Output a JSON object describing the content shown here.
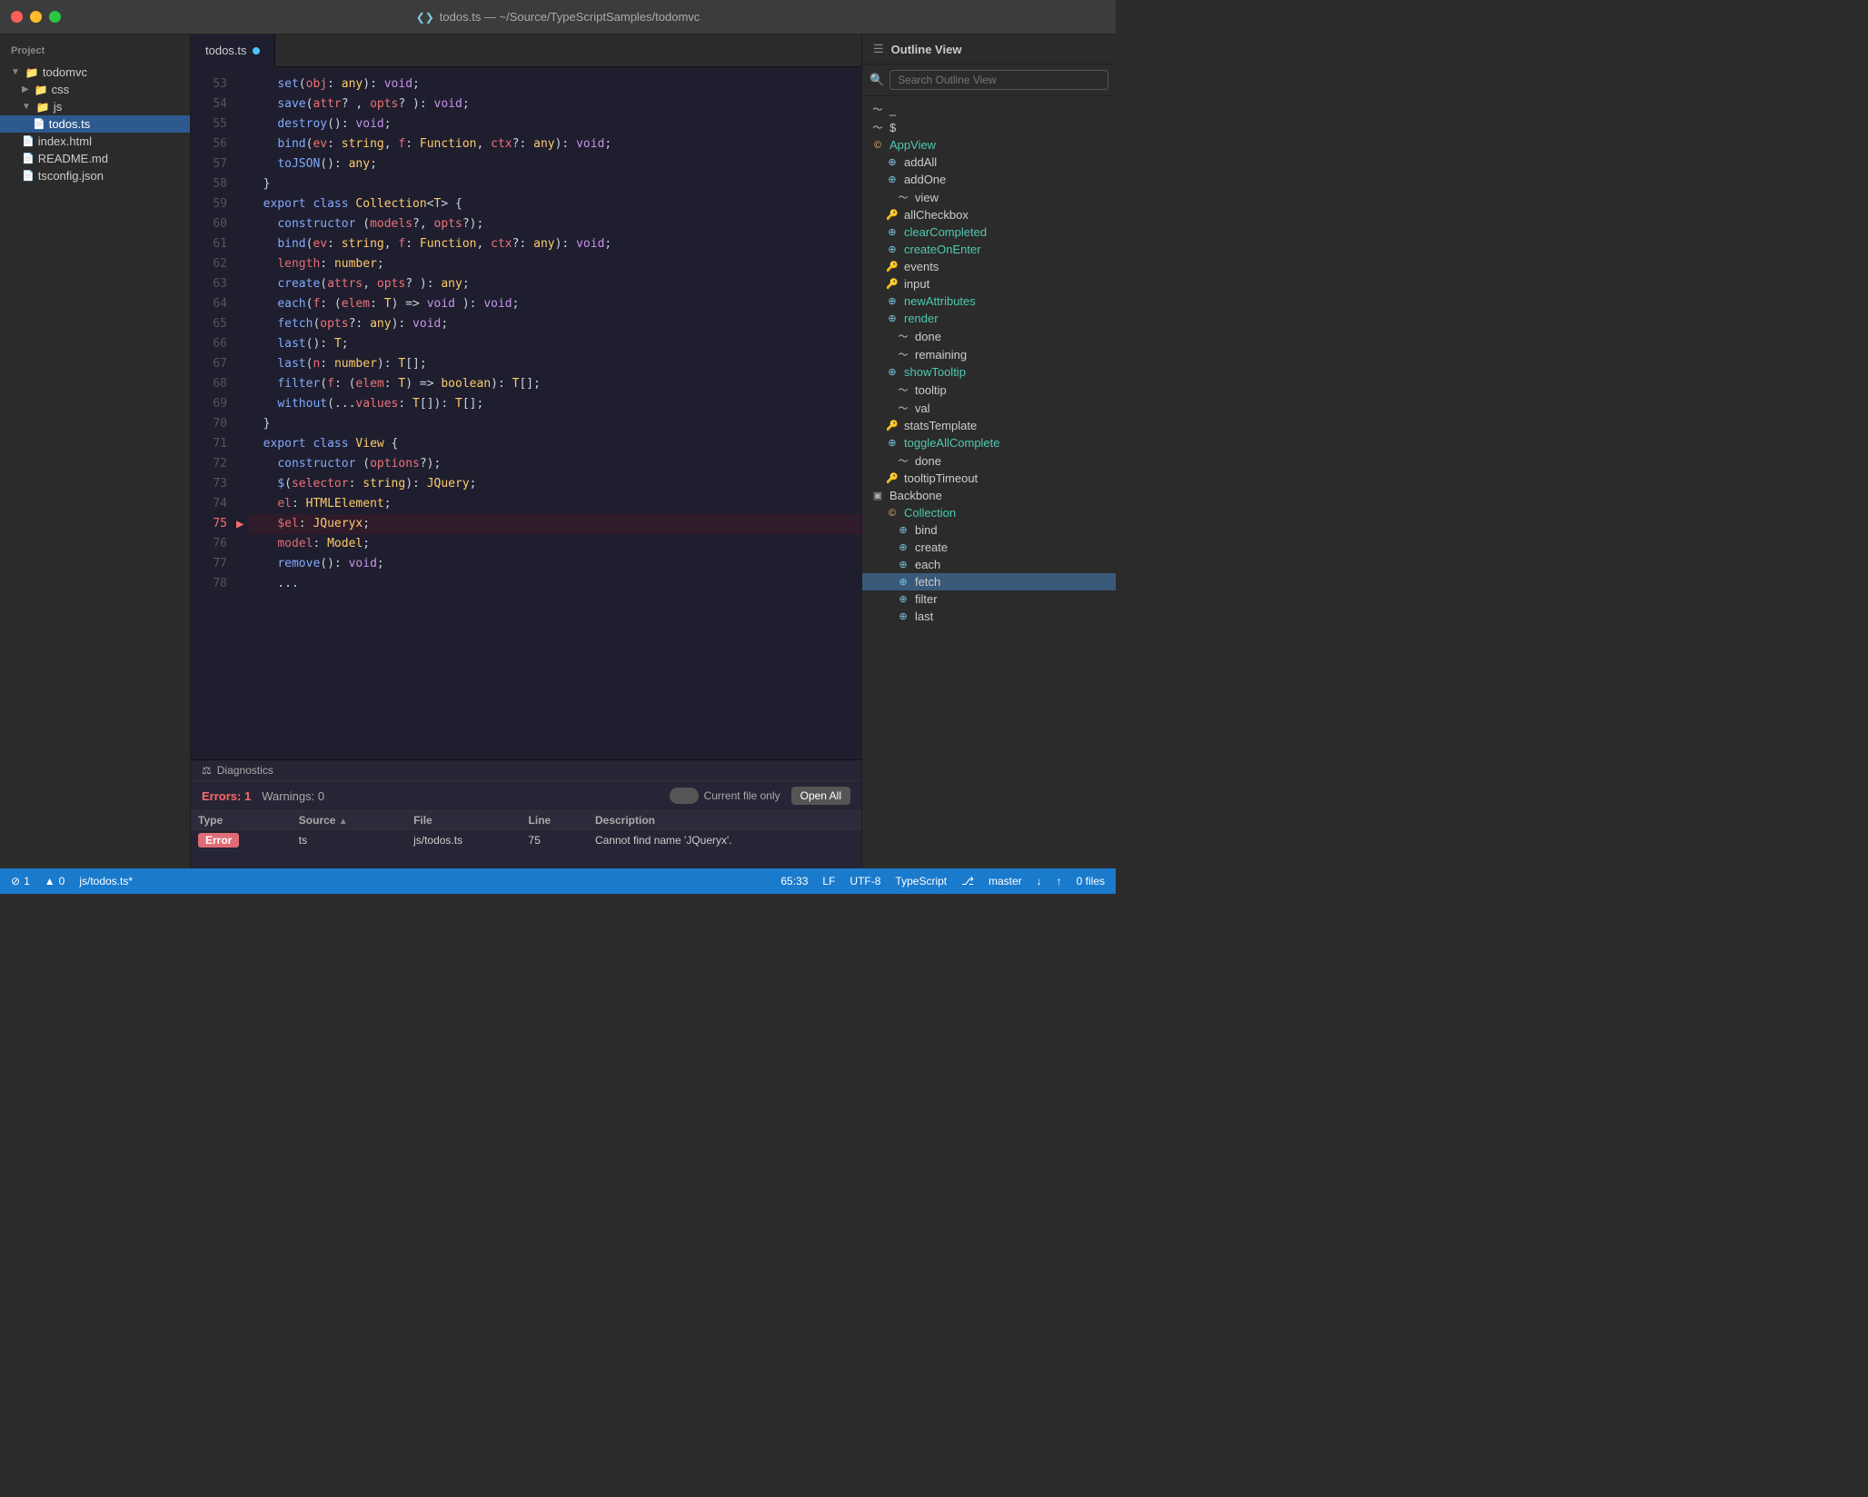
{
  "titleBar": {
    "title": "todos.ts — ~/Source/TypeScriptSamples/todomvc",
    "icon": "❮❯"
  },
  "sidebar": {
    "title": "Project",
    "items": [
      {
        "id": "todomvc",
        "label": "todomvc",
        "type": "folder",
        "level": 0,
        "expanded": true
      },
      {
        "id": "css",
        "label": "css",
        "type": "folder",
        "level": 1,
        "expanded": false
      },
      {
        "id": "js",
        "label": "js",
        "type": "folder",
        "level": 1,
        "expanded": true
      },
      {
        "id": "todos-ts",
        "label": "todos.ts",
        "type": "file",
        "level": 2,
        "selected": true
      },
      {
        "id": "index-html",
        "label": "index.html",
        "type": "file",
        "level": 1
      },
      {
        "id": "readme-md",
        "label": "README.md",
        "type": "file",
        "level": 1
      },
      {
        "id": "tsconfig-json",
        "label": "tsconfig.json",
        "type": "file",
        "level": 1
      }
    ]
  },
  "editor": {
    "filename": "todos.ts",
    "lines": [
      {
        "num": 53,
        "content": "    set(obj: any): void;"
      },
      {
        "num": 54,
        "content": "    save(attr? , opts? ): void;"
      },
      {
        "num": 55,
        "content": "    destroy(): void;"
      },
      {
        "num": 56,
        "content": "    bind(ev: string, f: Function, ctx?: any): void;"
      },
      {
        "num": 57,
        "content": "    toJSON(): any;"
      },
      {
        "num": 58,
        "content": "  }"
      },
      {
        "num": 59,
        "content": "  export class Collection<T> {"
      },
      {
        "num": 60,
        "content": "    constructor (models?, opts?);"
      },
      {
        "num": 61,
        "content": "    bind(ev: string, f: Function, ctx?: any): void;"
      },
      {
        "num": 62,
        "content": "    length: number;"
      },
      {
        "num": 63,
        "content": "    create(attrs, opts? ): any;"
      },
      {
        "num": 64,
        "content": "    each(f: (elem: T) => void ): void;"
      },
      {
        "num": 65,
        "content": "    fetch(opts?: any): void;"
      },
      {
        "num": 66,
        "content": "    last(): T;"
      },
      {
        "num": 67,
        "content": "    last(n: number): T[];"
      },
      {
        "num": 68,
        "content": "    filter(f: (elem: T) => boolean): T[];"
      },
      {
        "num": 69,
        "content": "    without(...values: T[]): T[];"
      },
      {
        "num": 70,
        "content": "  }"
      },
      {
        "num": 71,
        "content": "  export class View {"
      },
      {
        "num": 72,
        "content": "    constructor (options?);"
      },
      {
        "num": 73,
        "content": "    $(selector: string): JQuery;"
      },
      {
        "num": 74,
        "content": "    el: HTMLElement;"
      },
      {
        "num": 75,
        "content": "    $el: JQueryx;",
        "hasError": true,
        "isHighlighted": true
      },
      {
        "num": 76,
        "content": "    model: Model;"
      },
      {
        "num": 77,
        "content": "    remove(): void;"
      },
      {
        "num": 78,
        "content": "    ..."
      }
    ]
  },
  "diagnostics": {
    "title": "Diagnostics",
    "errorsCount": "1",
    "warningsCount": "0",
    "errorsLabel": "Errors: 1",
    "warningsLabel": "Warnings: 0",
    "currentFileOnly": "Current file only",
    "openAllButton": "Open All",
    "columns": [
      "Type",
      "Source ▲",
      "File",
      "Line",
      "Description"
    ],
    "rows": [
      {
        "type": "Error",
        "source": "ts",
        "file": "js/todos.ts",
        "line": "75",
        "description": "Cannot find name 'JQueryx'."
      }
    ]
  },
  "outline": {
    "title": "Outline View",
    "searchPlaceholder": "Search Outline View",
    "items": [
      {
        "id": "_",
        "label": "_",
        "icon": "curve",
        "level": 0
      },
      {
        "id": "$",
        "label": "$",
        "icon": "curve",
        "level": 0
      },
      {
        "id": "AppView",
        "label": "AppView",
        "icon": "class",
        "level": 0,
        "color": "cyan"
      },
      {
        "id": "addAll",
        "label": "addAll",
        "icon": "method",
        "level": 1
      },
      {
        "id": "addOne",
        "label": "addOne",
        "icon": "method",
        "level": 1
      },
      {
        "id": "view",
        "label": "view",
        "icon": "curve",
        "level": 2
      },
      {
        "id": "allCheckbox",
        "label": "allCheckbox",
        "icon": "key",
        "level": 1
      },
      {
        "id": "clearCompleted",
        "label": "clearCompleted",
        "icon": "method",
        "level": 1,
        "color": "cyan"
      },
      {
        "id": "createOnEnter",
        "label": "createOnEnter",
        "icon": "method",
        "level": 1,
        "color": "cyan"
      },
      {
        "id": "events",
        "label": "events",
        "icon": "key",
        "level": 1
      },
      {
        "id": "input",
        "label": "input",
        "icon": "key",
        "level": 1
      },
      {
        "id": "newAttributes",
        "label": "newAttributes",
        "icon": "method",
        "level": 1,
        "color": "cyan"
      },
      {
        "id": "render",
        "label": "render",
        "icon": "method",
        "level": 1,
        "color": "cyan"
      },
      {
        "id": "done",
        "label": "done",
        "icon": "curve",
        "level": 2
      },
      {
        "id": "remaining",
        "label": "remaining",
        "icon": "curve",
        "level": 2
      },
      {
        "id": "showTooltip",
        "label": "showTooltip",
        "icon": "method",
        "level": 1,
        "color": "cyan"
      },
      {
        "id": "tooltip",
        "label": "tooltip",
        "icon": "curve",
        "level": 2
      },
      {
        "id": "val",
        "label": "val",
        "icon": "curve",
        "level": 2
      },
      {
        "id": "statsTemplate",
        "label": "statsTemplate",
        "icon": "key",
        "level": 1
      },
      {
        "id": "toggleAllComplete",
        "label": "toggleAllComplete",
        "icon": "method",
        "level": 1,
        "color": "cyan"
      },
      {
        "id": "done2",
        "label": "done",
        "icon": "curve",
        "level": 2
      },
      {
        "id": "tooltipTimeout",
        "label": "tooltipTimeout",
        "icon": "key",
        "level": 1
      },
      {
        "id": "Backbone",
        "label": "Backbone",
        "icon": "namespace",
        "level": 0
      },
      {
        "id": "Collection",
        "label": "Collection",
        "icon": "class",
        "level": 1,
        "color": "cyan"
      },
      {
        "id": "bind",
        "label": "bind",
        "icon": "method",
        "level": 2
      },
      {
        "id": "create",
        "label": "create",
        "icon": "method",
        "level": 2
      },
      {
        "id": "each",
        "label": "each",
        "icon": "method",
        "level": 2
      },
      {
        "id": "fetch",
        "label": "fetch",
        "icon": "method",
        "level": 2,
        "selected": true
      },
      {
        "id": "filter",
        "label": "filter",
        "icon": "method",
        "level": 2
      },
      {
        "id": "last",
        "label": "last",
        "icon": "method",
        "level": 2
      }
    ]
  },
  "statusBar": {
    "errors": "1",
    "warnings": "0",
    "filePath": "js/todos.ts*",
    "lineCol": "65:33",
    "encoding": "LF",
    "charset": "UTF-8",
    "language": "TypeScript",
    "branch": "master",
    "files": "0 files"
  }
}
